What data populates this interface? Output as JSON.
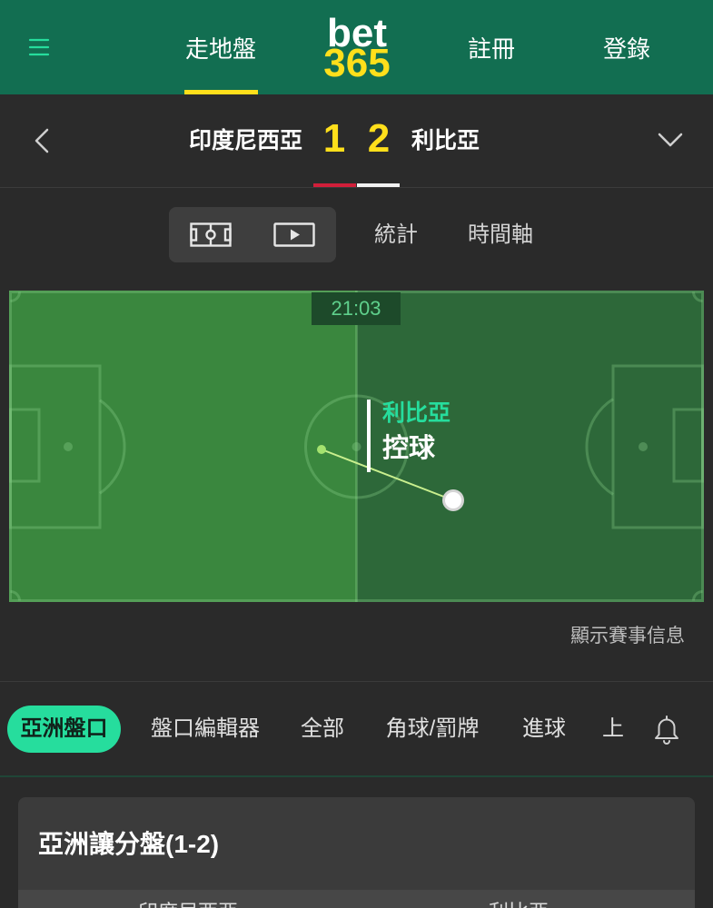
{
  "header": {
    "menu_icon": "hamburger-menu-icon",
    "inplay_tab": "走地盤",
    "logo": {
      "top": "bet",
      "bottom": "365"
    },
    "register": "註冊",
    "login": "登錄"
  },
  "scoreboard": {
    "back_icon": "chevron-left-icon",
    "home_team": "印度尼西亞",
    "home_score": "1",
    "away_score": "2",
    "away_team": "利比亞",
    "expand_icon": "chevron-down-icon"
  },
  "view_tabs": {
    "pitch_view_icon": "pitch-icon",
    "video_view_icon": "play-video-icon",
    "stats": "統計",
    "timeline": "時間軸"
  },
  "pitch": {
    "clock": "21:03",
    "possession_team": "利比亞",
    "possession_label": "控球"
  },
  "show_info_link": "顯示賽事信息",
  "market_tabs": [
    {
      "label": "亞洲盤口",
      "active": true
    },
    {
      "label": "盤口編輯器",
      "active": false
    },
    {
      "label": "全部",
      "active": false
    },
    {
      "label": "角球/罰牌",
      "active": false
    },
    {
      "label": "進球",
      "active": false
    },
    {
      "label": "上",
      "active": false
    }
  ],
  "notifications_icon": "bell-icon",
  "market_card": {
    "title": "亞洲讓分盤(1-2)",
    "columns": [
      "印度尼西亞",
      "利比亞"
    ]
  },
  "colors": {
    "brand_green": "#126e51",
    "accent_yellow": "#ffdf1b",
    "accent_mint": "#26dd9d",
    "home_team_color": "#d11f3a",
    "away_team_color": "#f2f2f2"
  }
}
